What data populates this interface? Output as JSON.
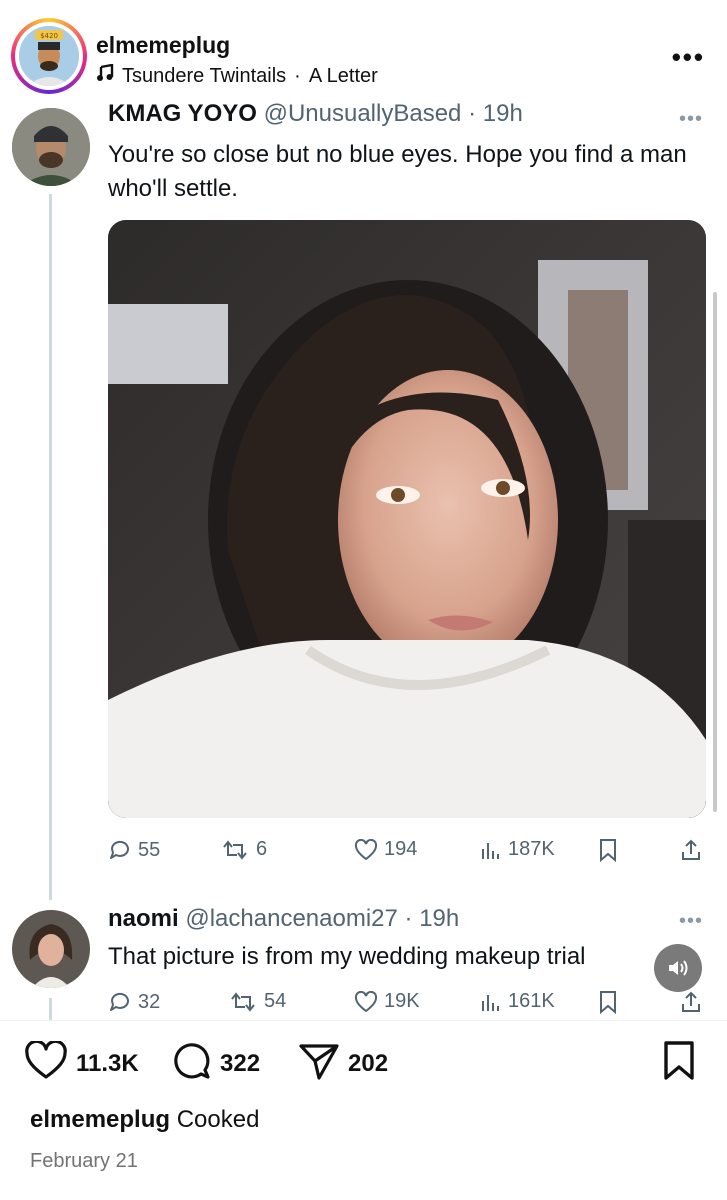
{
  "ig_post": {
    "username": "elmemeplug",
    "avatar_badge": "$420",
    "song_title": "Tsundere Twintails",
    "song_separator": "·",
    "song_artist": "A Letter",
    "more_icon": "more-horizontal-icon"
  },
  "tweet_1": {
    "display_name": "KMAG YOYO",
    "handle": "@UnusuallyBased",
    "separator": "·",
    "time": "19h",
    "text": "You're so close but no blue eyes. Hope you find a man who'll settle.",
    "actions": {
      "replies": "55",
      "retweets": "6",
      "likes": "194",
      "views": "187K"
    }
  },
  "tweet_2": {
    "display_name": "naomi",
    "handle": "@lachancenaomi27",
    "separator": "·",
    "time": "19h",
    "text": "That picture is from my wedding makeup trial",
    "actions": {
      "replies": "32",
      "retweets": "54",
      "likes": "19K",
      "views": "161K"
    }
  },
  "ig_actions": {
    "likes": "11.3K",
    "comments": "322",
    "shares": "202"
  },
  "caption": {
    "username": "elmemeplug",
    "text": "Cooked"
  },
  "date": "February 21",
  "colors": {
    "text": "#0f1419",
    "muted": "#536471",
    "thread_line": "#cfd9de"
  }
}
